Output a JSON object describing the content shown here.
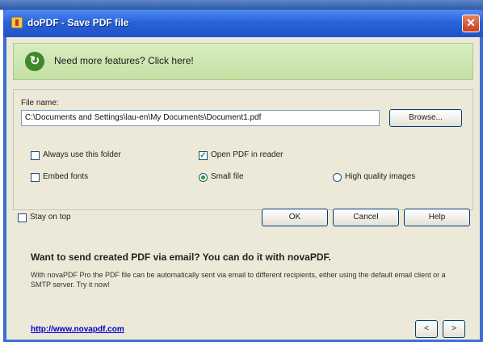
{
  "window": {
    "title": "doPDF - Save PDF file",
    "close_glyph": "✕"
  },
  "banner": {
    "icon_glyph": "↻",
    "text": "Need more features? Click here!"
  },
  "form": {
    "file_name_label": "File name:",
    "file_name_value": "C:\\Documents and Settings\\lau-en\\My Documents\\Document1.pdf",
    "browse_label": "Browse...",
    "always_use_folder": {
      "label": "Always use this folder",
      "checked": false
    },
    "open_pdf_reader": {
      "label": "Open PDF in reader",
      "checked": true
    },
    "embed_fonts": {
      "label": "Embed fonts",
      "checked": false
    },
    "small_file": {
      "label": "Small file",
      "selected": true
    },
    "high_quality": {
      "label": "High quality images",
      "selected": false
    }
  },
  "footer_controls": {
    "stay_on_top": {
      "label": "Stay on top",
      "checked": false
    },
    "ok_label": "OK",
    "cancel_label": "Cancel",
    "help_label": "Help"
  },
  "promo": {
    "headline": "Want to send created PDF via email? You can do it with novaPDF.",
    "body": "With novaPDF Pro the PDF file can be automatically sent via email to different recipients, either using the default email client or a SMTP server. Try it now!",
    "link": "http://www.novapdf.com",
    "prev_label": "<",
    "next_label": ">"
  },
  "icons": {
    "app_icon": "dopdf-app-icon",
    "banner_icon": "refresh-circle-icon"
  },
  "colors": {
    "titlebar": "#2a63d8",
    "banner": "#c4e1a4",
    "dialog_bg": "#ece9d8",
    "link": "#0000cc"
  }
}
